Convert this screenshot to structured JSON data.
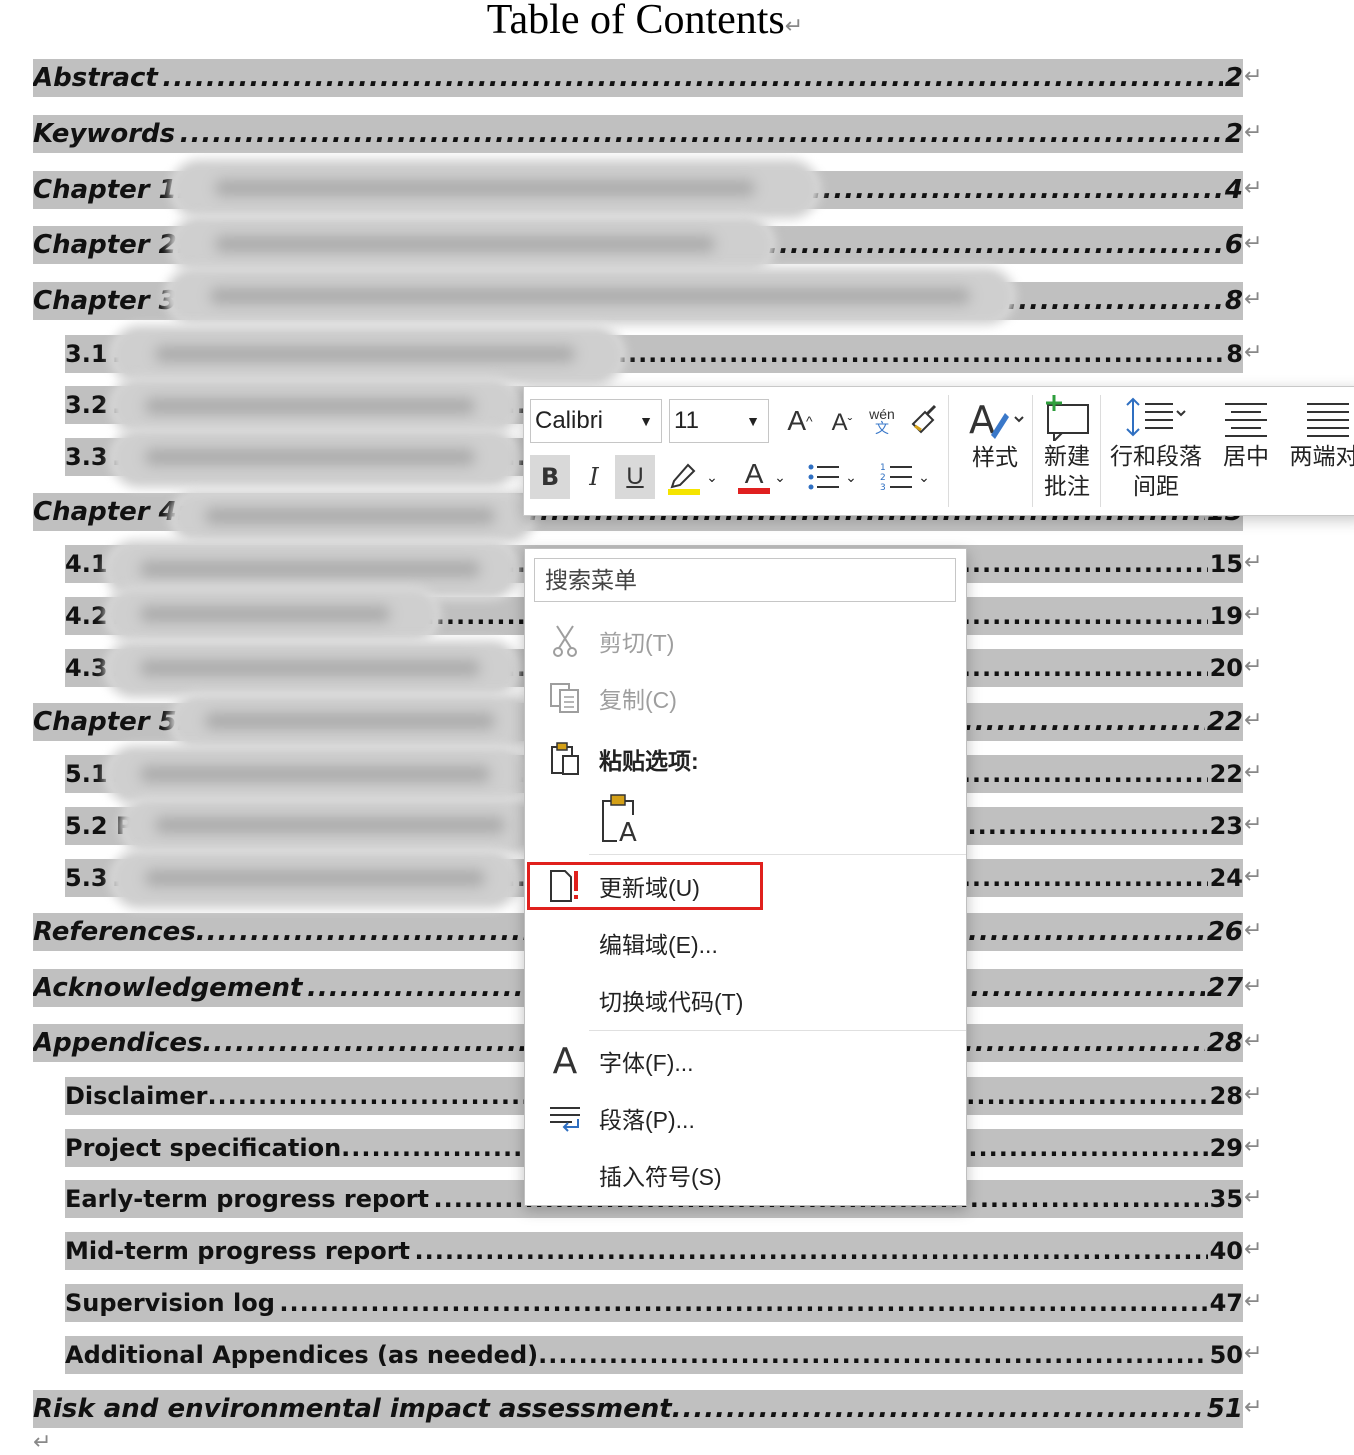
{
  "document": {
    "title": "Table of Contents",
    "return_mark": "↵"
  },
  "toc": [
    {
      "label": "Abstract",
      "page": "2"
    },
    {
      "label": "Keywords",
      "page": "2"
    },
    {
      "label": "Chapter 1:",
      "page": "4"
    },
    {
      "label": "Chapter 2:",
      "page": "6"
    },
    {
      "label": "Chapter 3:",
      "page": "8"
    },
    {
      "label": "3.1",
      "page": "8"
    },
    {
      "label": "3.2",
      "page": ""
    },
    {
      "label": "3.3",
      "page": ""
    },
    {
      "label": "Chapter 4:",
      "page": "13"
    },
    {
      "label": "4.1",
      "page": "15"
    },
    {
      "label": "4.2",
      "page": "19"
    },
    {
      "label": "4.3",
      "page": "20"
    },
    {
      "label": "Chapter 5:",
      "page": "22"
    },
    {
      "label": "5.1",
      "page": "22"
    },
    {
      "label": "5.2 P",
      "page": "23"
    },
    {
      "label": "5.3",
      "page": "24"
    },
    {
      "label": "References",
      "page": "26"
    },
    {
      "label": "Acknowledgement",
      "page": "27"
    },
    {
      "label": "Appendices",
      "page": "28"
    },
    {
      "label": "Disclaimer",
      "page": "28"
    },
    {
      "label": "Project specification",
      "page": "29"
    },
    {
      "label": "Early-term progress report",
      "page": "35"
    },
    {
      "label": "Mid-term progress report",
      "page": "40"
    },
    {
      "label": "Supervision log",
      "page": "47"
    },
    {
      "label": "Additional Appendices (as needed)",
      "page": "50"
    },
    {
      "label": "Risk and environmental impact assessment",
      "page": "51"
    }
  ],
  "mini_toolbar": {
    "font_name": "Calibri",
    "font_size": "11",
    "grow_font": "A",
    "shrink_font": "A",
    "phonetic_top": "wén",
    "phonetic_bottom": "文",
    "bold": "B",
    "italic": "I",
    "underline": "U",
    "font_color_glyph": "A",
    "styles_label": "样式",
    "new_comment_label_1": "新建",
    "new_comment_label_2": "批注",
    "line_spacing_label_1": "行和段落",
    "line_spacing_label_2": "间距",
    "center_label": "居中",
    "justify_label": "两端对",
    "highlight_color": "#f5e400",
    "font_color": "#e02020"
  },
  "context_menu": {
    "search_placeholder": "搜索菜单",
    "cut": "剪切(T)",
    "copy": "复制(C)",
    "paste_options": "粘贴选项:",
    "update_field": "更新域(U)",
    "edit_field": "编辑域(E)...",
    "toggle_field_codes": "切换域代码(T)",
    "font": "字体(F)...",
    "paragraph": "段落(P)...",
    "insert_symbol": "插入符号(S)",
    "highlight_color": "#e0201d"
  }
}
